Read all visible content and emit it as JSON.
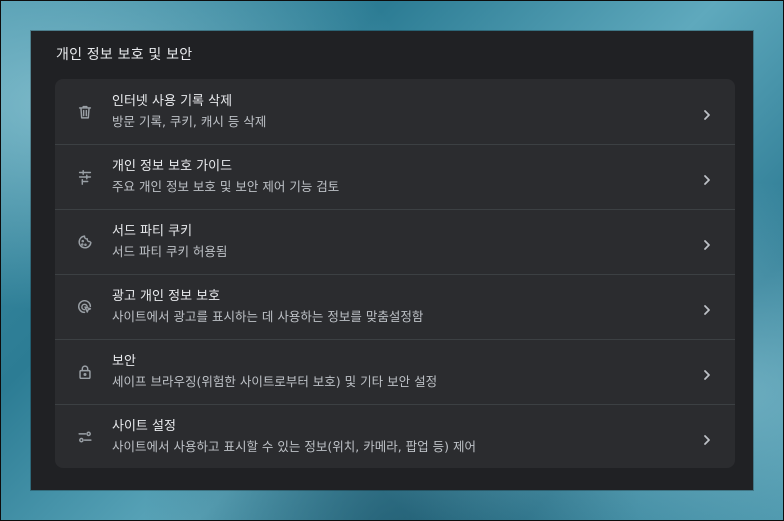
{
  "section": {
    "title": "개인 정보 보호 및 보안"
  },
  "items": [
    {
      "icon": "trash-icon",
      "title": "인터넷 사용 기록 삭제",
      "subtitle": "방문 기록, 쿠키, 캐시 등 삭제"
    },
    {
      "icon": "privacy-guide-icon",
      "title": "개인 정보 보호 가이드",
      "subtitle": "주요 개인 정보 보호 및 보안 제어 기능 검토"
    },
    {
      "icon": "cookie-icon",
      "title": "서드 파티 쿠키",
      "subtitle": "서드 파티 쿠키 허용됨"
    },
    {
      "icon": "ad-privacy-icon",
      "title": "광고 개인 정보 보호",
      "subtitle": "사이트에서 광고를 표시하는 데 사용하는 정보를 맞춤설정함"
    },
    {
      "icon": "lock-icon",
      "title": "보안",
      "subtitle": "세이프 브라우징(위험한 사이트로부터 보호) 및 기타 보안 설정"
    },
    {
      "icon": "site-settings-icon",
      "title": "사이트 설정",
      "subtitle": "사이트에서 사용하고 표시할 수 있는 정보(위치, 카메라, 팝업 등) 제어"
    }
  ],
  "colors": {
    "panel_bg": "#202124",
    "card_bg": "#2b2c2f",
    "text_primary": "#e8eaed",
    "text_secondary": "#bdc1c6",
    "icon": "#9aa0a6"
  }
}
